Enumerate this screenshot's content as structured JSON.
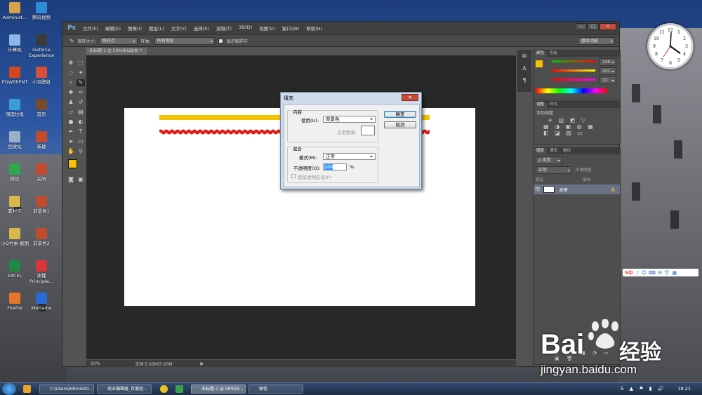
{
  "desktop": {
    "icons": [
      {
        "label": "Administ...",
        "color": "#d8a24a"
      },
      {
        "label": "腾讯视频",
        "color": "#2f8ad8"
      },
      {
        "label": "计算机",
        "color": "#8ab6e8"
      },
      {
        "label": "Geforce Experience",
        "color": "#3b3b3b"
      },
      {
        "label": "POWERPNT",
        "color": "#d2471f"
      },
      {
        "label": "小鸟壁纸",
        "color": "#d84f3c"
      },
      {
        "label": "强理垃圾",
        "color": "#3c9cd8"
      },
      {
        "label": "首页",
        "color": "#7a4a2a"
      },
      {
        "label": "回收站",
        "color": "#9ab0c8"
      },
      {
        "label": "新建",
        "color": "#c24b2e"
      },
      {
        "label": "微信",
        "color": "#2ea84a"
      },
      {
        "label": "关闭",
        "color": "#c24b2e"
      },
      {
        "label": "素材库",
        "color": "#d8b84a"
      },
      {
        "label": "前景色1",
        "color": "#c24b2e"
      },
      {
        "label": "小Q书桌-截图",
        "color": "#d8b84a"
      },
      {
        "label": "前景色2",
        "color": "#c24b2e"
      },
      {
        "label": "EXCEL",
        "color": "#1f8a44"
      },
      {
        "label": "读懂 Principle...",
        "color": "#d8343a"
      },
      {
        "label": "Firefox",
        "color": "#e8752a"
      },
      {
        "label": "WeGame",
        "color": "#2a6ad8"
      }
    ]
  },
  "ps": {
    "logo": "Ps",
    "menus": [
      "文件(F)",
      "编辑(E)",
      "图像(I)",
      "图层(L)",
      "文字(Y)",
      "选择(S)",
      "滤镜(T)",
      "3D(D)",
      "视图(V)",
      "窗口(W)",
      "帮助(H)"
    ],
    "window_buttons": [
      "—",
      "□",
      "✕"
    ],
    "options": {
      "sample_size_label": "取样大小:",
      "sample_size_value": "取样点",
      "sample_label": "样本:",
      "sample_value": "所有图层",
      "show_ring_label": "显示取样环",
      "workspace": "基本功能"
    },
    "doc_tab": "未标题-1 @ 50%(RGB/8) * ×",
    "status": {
      "zoom": "50%",
      "doc": "文档:5.93M/5.93M"
    },
    "panels": {
      "color": {
        "tabs": [
          "颜色",
          "色板"
        ],
        "r": "240",
        "g": "201",
        "b": "12"
      },
      "adjust": {
        "tabs": [
          "调整",
          "样式"
        ],
        "title": "添加调整"
      },
      "layers": {
        "tabs": [
          "图层",
          "通道",
          "路径"
        ],
        "filter": "ρ 类型",
        "blend": "正常",
        "opacity_label": "不透明度:",
        "lock_label": "锁定:",
        "fill_label": "填充:",
        "layer_name": "背景"
      }
    }
  },
  "dialog": {
    "title": "填充",
    "content_legend": "内容",
    "use_label": "使用(U):",
    "use_value": "背景色",
    "custom_pattern_label": "自定图案:",
    "blend_legend": "混合",
    "mode_label": "模式(M):",
    "mode_value": "正常",
    "opacity_label": "不透明度(O):",
    "opacity_value": "100",
    "opacity_unit": "%",
    "preserve_label": "保留透明区域(P)",
    "ok": "确定",
    "cancel": "取消"
  },
  "taskbar": {
    "tasks": [
      "C:\\Users\\Administr...",
      "现业编辑器_百度经...",
      "未标题-1 @ 50%(R...",
      "微信"
    ],
    "time": "18:21"
  },
  "watermark": {
    "brand": "Bai",
    "brand2": "经验",
    "url": "jingyan.baidu.com"
  },
  "ime": {
    "label": "S中"
  },
  "colors": {
    "fg": "#f5c400",
    "bg": "#e31b14",
    "ps_dark": "#282828",
    "stripe_yellow": "#f5c400",
    "stripe_red": "#e31b14"
  }
}
